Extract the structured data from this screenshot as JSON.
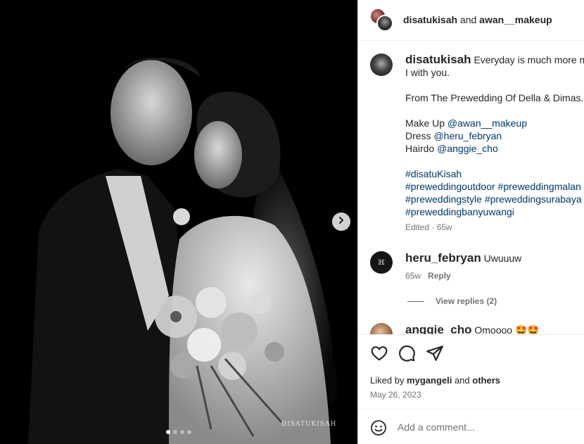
{
  "header": {
    "user1": "disatukisah",
    "joiner": " and ",
    "user2": "awan__makeup"
  },
  "caption": {
    "username": "disatukisah",
    "line1": "Everyday is much more me",
    "line2": "I with you.",
    "line3": "From The Prewedding Of Della & Dimas.",
    "makeup_prefix": "Make Up ",
    "makeup_link": "@awan__makeup",
    "dress_prefix": "Dress ",
    "dress_link": "@heru_febryan",
    "hair_prefix": "Hairdo ",
    "hair_link": "@anggie_cho",
    "tags": [
      "#disatuKisah",
      "#preweddingoutdoor #preweddingmalan",
      "#preweddingstyle #preweddingsurabaya",
      "#preweddingbanyuwangi"
    ],
    "edited": "Edited",
    "time": "65w"
  },
  "comments": [
    {
      "username": "heru_febryan",
      "text": "Uwuuuw",
      "time": "65w",
      "reply": "Reply",
      "view_replies": "View replies (2)"
    },
    {
      "username": "anggie_cho",
      "text": "Omoooo 🤩🤩"
    }
  ],
  "likes": {
    "prefix": "Liked by ",
    "user": "mygangeli",
    "middle": " and ",
    "others": "others"
  },
  "date": "May 26, 2023",
  "add_comment": {
    "placeholder": "Add a comment..."
  },
  "media": {
    "watermark": "DISATUKISAH",
    "slide_count": 4,
    "active_slide": 1
  },
  "icons": {
    "like": "heart-icon",
    "comment": "comment-icon",
    "share": "share-icon",
    "next": "chevron-right-icon",
    "emoji": "emoji-icon"
  },
  "colors": {
    "link": "#00376b",
    "muted": "#737373",
    "text": "#262626"
  }
}
